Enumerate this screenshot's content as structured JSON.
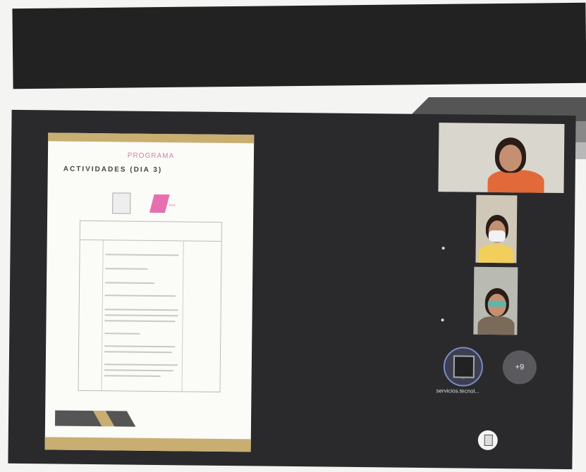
{
  "presentation": {
    "document": {
      "subtitle": "PROGRAMA",
      "title": "ACTIVIDADES (DIA 3)"
    }
  },
  "participants": {
    "overflow_label": "+9",
    "named_tile": {
      "label": "servicios.tecnol..."
    }
  },
  "colors": {
    "meeting_bg": "#2a2a2c",
    "doc_accent": "#c9ae72",
    "brand_pink": "#e76fb0"
  }
}
